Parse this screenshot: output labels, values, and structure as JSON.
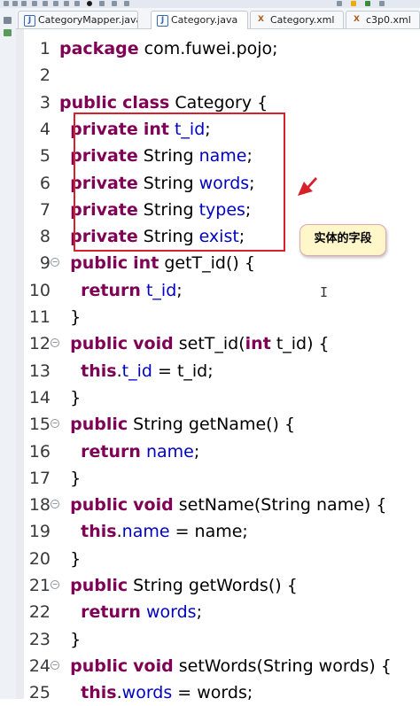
{
  "tabs": [
    {
      "label": "CategoryMapper.java",
      "icon": "java-file-icon",
      "active": false
    },
    {
      "label": "Category.java",
      "icon": "java-file-icon",
      "active": true
    },
    {
      "label": "Category.xml",
      "icon": "xml-file-icon",
      "active": false
    },
    {
      "label": "c3p0.xml",
      "icon": "xml-file-icon",
      "active": false
    }
  ],
  "annotation": {
    "callout_text": "实体的字段",
    "box_color": "#d7212a",
    "callout_bg": "#fff6c9"
  },
  "colors": {
    "keyword": "#7f0055",
    "field": "#0000c0",
    "text": "#000000"
  },
  "lines": [
    {
      "n": "1",
      "tokens": [
        [
          "kw",
          "package"
        ],
        [
          "t",
          " com.fuwei.pojo;"
        ]
      ]
    },
    {
      "n": "2",
      "tokens": []
    },
    {
      "n": "3",
      "tokens": [
        [
          "kw",
          "public"
        ],
        [
          "t",
          " "
        ],
        [
          "kw",
          "class"
        ],
        [
          "t",
          " Category {"
        ]
      ]
    },
    {
      "n": "4",
      "tokens": [
        [
          "t",
          "  "
        ],
        [
          "kw",
          "private"
        ],
        [
          "t",
          " "
        ],
        [
          "kw",
          "int"
        ],
        [
          "t",
          " "
        ],
        [
          "f",
          "t_id"
        ],
        [
          "t",
          ";"
        ]
      ]
    },
    {
      "n": "5",
      "tokens": [
        [
          "t",
          "  "
        ],
        [
          "kw",
          "private"
        ],
        [
          "t",
          " String "
        ],
        [
          "f",
          "name"
        ],
        [
          "t",
          ";"
        ]
      ]
    },
    {
      "n": "6",
      "tokens": [
        [
          "t",
          "  "
        ],
        [
          "kw",
          "private"
        ],
        [
          "t",
          " String "
        ],
        [
          "f",
          "words"
        ],
        [
          "t",
          ";"
        ]
      ]
    },
    {
      "n": "7",
      "tokens": [
        [
          "t",
          "  "
        ],
        [
          "kw",
          "private"
        ],
        [
          "t",
          " String "
        ],
        [
          "f",
          "types"
        ],
        [
          "t",
          ";"
        ]
      ]
    },
    {
      "n": "8",
      "tokens": [
        [
          "t",
          "  "
        ],
        [
          "kw",
          "private"
        ],
        [
          "t",
          " String "
        ],
        [
          "f",
          "exist"
        ],
        [
          "t",
          ";"
        ]
      ]
    },
    {
      "n": "9",
      "fold": true,
      "tokens": [
        [
          "t",
          "  "
        ],
        [
          "kw",
          "public"
        ],
        [
          "t",
          " "
        ],
        [
          "kw",
          "int"
        ],
        [
          "t",
          " getT_id() {"
        ]
      ]
    },
    {
      "n": "10",
      "tokens": [
        [
          "t",
          "    "
        ],
        [
          "kw",
          "return"
        ],
        [
          "t",
          " "
        ],
        [
          "f",
          "t_id"
        ],
        [
          "t",
          ";"
        ]
      ]
    },
    {
      "n": "11",
      "tokens": [
        [
          "t",
          "  }"
        ]
      ]
    },
    {
      "n": "12",
      "fold": true,
      "tokens": [
        [
          "t",
          "  "
        ],
        [
          "kw",
          "public"
        ],
        [
          "t",
          " "
        ],
        [
          "kw",
          "void"
        ],
        [
          "t",
          " setT_id("
        ],
        [
          "kw",
          "int"
        ],
        [
          "t",
          " t_id) {"
        ]
      ]
    },
    {
      "n": "13",
      "tokens": [
        [
          "t",
          "    "
        ],
        [
          "kw",
          "this"
        ],
        [
          "t",
          "."
        ],
        [
          "f",
          "t_id"
        ],
        [
          "t",
          " = t_id;"
        ]
      ]
    },
    {
      "n": "14",
      "tokens": [
        [
          "t",
          "  }"
        ]
      ]
    },
    {
      "n": "15",
      "fold": true,
      "tokens": [
        [
          "t",
          "  "
        ],
        [
          "kw",
          "public"
        ],
        [
          "t",
          " String getName() {"
        ]
      ]
    },
    {
      "n": "16",
      "tokens": [
        [
          "t",
          "    "
        ],
        [
          "kw",
          "return"
        ],
        [
          "t",
          " "
        ],
        [
          "f",
          "name"
        ],
        [
          "t",
          ";"
        ]
      ]
    },
    {
      "n": "17",
      "tokens": [
        [
          "t",
          "  }"
        ]
      ]
    },
    {
      "n": "18",
      "fold": true,
      "tokens": [
        [
          "t",
          "  "
        ],
        [
          "kw",
          "public"
        ],
        [
          "t",
          " "
        ],
        [
          "kw",
          "void"
        ],
        [
          "t",
          " setName(String name) {"
        ]
      ]
    },
    {
      "n": "19",
      "tokens": [
        [
          "t",
          "    "
        ],
        [
          "kw",
          "this"
        ],
        [
          "t",
          "."
        ],
        [
          "f",
          "name"
        ],
        [
          "t",
          " = name;"
        ]
      ]
    },
    {
      "n": "20",
      "tokens": [
        [
          "t",
          "  }"
        ]
      ]
    },
    {
      "n": "21",
      "fold": true,
      "tokens": [
        [
          "t",
          "  "
        ],
        [
          "kw",
          "public"
        ],
        [
          "t",
          " String getWords() {"
        ]
      ]
    },
    {
      "n": "22",
      "tokens": [
        [
          "t",
          "    "
        ],
        [
          "kw",
          "return"
        ],
        [
          "t",
          " "
        ],
        [
          "f",
          "words"
        ],
        [
          "t",
          ";"
        ]
      ]
    },
    {
      "n": "23",
      "tokens": [
        [
          "t",
          "  }"
        ]
      ]
    },
    {
      "n": "24",
      "fold": true,
      "tokens": [
        [
          "t",
          "  "
        ],
        [
          "kw",
          "public"
        ],
        [
          "t",
          " "
        ],
        [
          "kw",
          "void"
        ],
        [
          "t",
          " setWords(String words) {"
        ]
      ]
    },
    {
      "n": "25",
      "tokens": [
        [
          "t",
          "    "
        ],
        [
          "kw",
          "this"
        ],
        [
          "t",
          "."
        ],
        [
          "f",
          "words"
        ],
        [
          "t",
          " = words;"
        ]
      ]
    }
  ]
}
